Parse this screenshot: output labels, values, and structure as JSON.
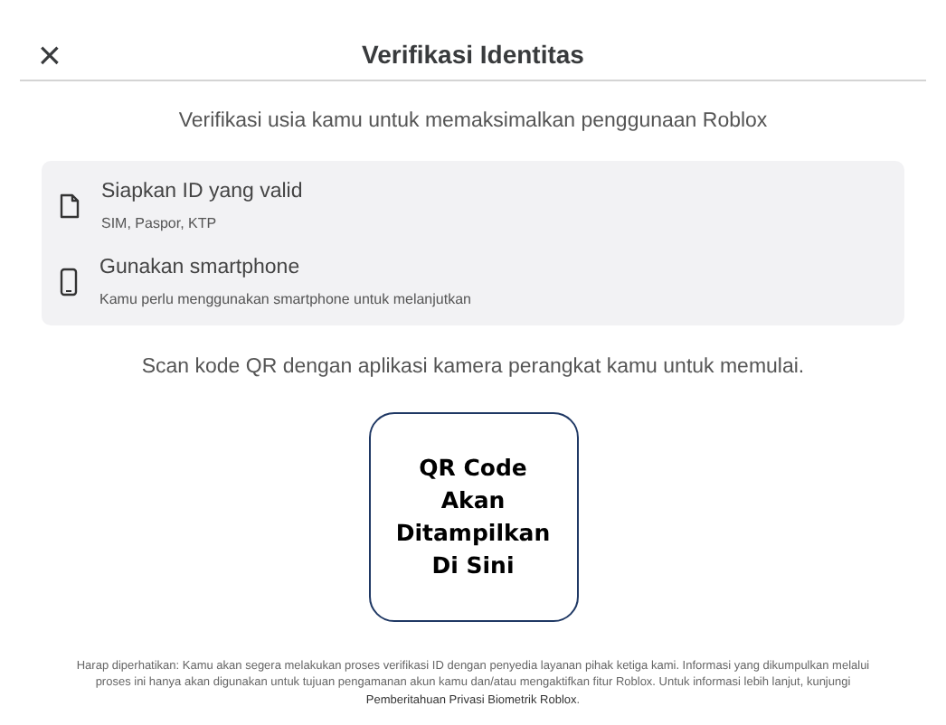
{
  "header": {
    "close": "×",
    "title": "Verifikasi Identitas"
  },
  "subtitle": "Verifikasi usia kamu untuk memaksimalkan penggunaan Roblox",
  "requirements": [
    {
      "kind": "document",
      "title": "Siapkan ID yang valid",
      "detail": "SIM, Paspor, KTP"
    },
    {
      "kind": "phone",
      "title": "Gunakan smartphone",
      "detail": "Kamu perlu menggunakan smartphone untuk melanjutkan"
    }
  ],
  "instruction": "Scan kode QR dengan aplikasi kamera perangkat kamu untuk memulai.",
  "qr_placeholder": [
    "QR Code",
    "Akan",
    "Ditampilkan",
    "Di Sini"
  ],
  "footnote": {
    "text": "Harap diperhatikan: Kamu akan segera melakukan proses verifikasi ID dengan penyedia layanan pihak ketiga kami. Informasi yang dikumpulkan melalui proses ini hanya akan digunakan untuk tujuan pengamanan akun kamu dan/atau mengaktifkan fitur Roblox. Untuk informasi lebih lanjut, kunjungi",
    "link": "Pemberitahuan Privasi Biometrik Roblox",
    "end": "."
  }
}
